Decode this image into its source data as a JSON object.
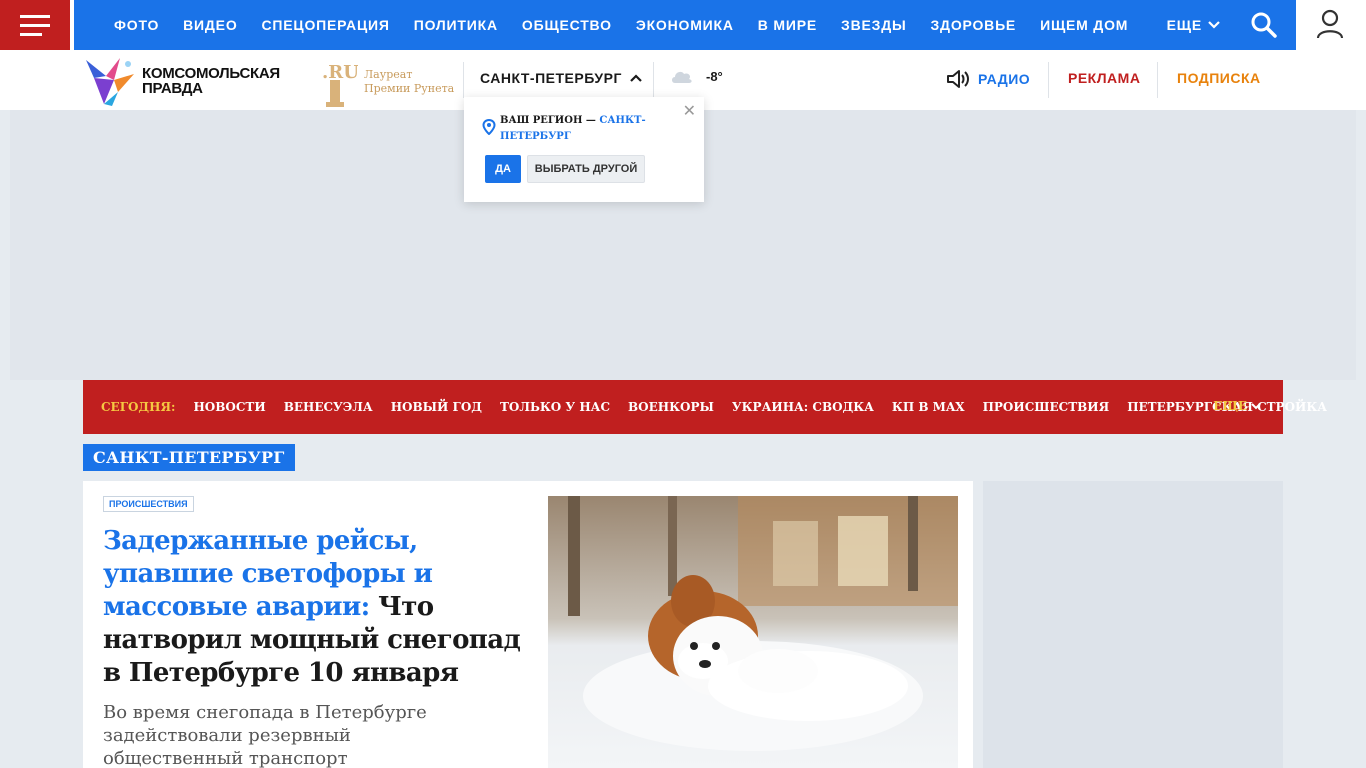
{
  "nav": {
    "items": [
      "ФОТО",
      "ВИДЕО",
      "СПЕЦОПЕРАЦИЯ",
      "ПОЛИТИКА",
      "ОБЩЕСТВО",
      "ЭКОНОМИКА",
      "В МИРЕ",
      "ЗВЕЗДЫ",
      "ЗДОРОВЬЕ",
      "ИЩЕМ ДОМ"
    ],
    "more_label": "ЕЩЕ"
  },
  "header": {
    "logo_line1": "КОМСОМОЛЬСКАЯ",
    "logo_line2": "ПРАВДА",
    "laureate_line1": "Лауреат",
    "laureate_line2": "Премии Рунета",
    "city": "САНКТ-ПЕТЕРБУРГ",
    "temperature": "-8°",
    "radio_label": "РАДИО",
    "ads_label": "РЕКЛАМА",
    "subscribe_label": "ПОДПИСКА"
  },
  "region_popup": {
    "prefix": "ВАШ РЕГИОН —",
    "region": "САНКТ-ПЕТЕРБУРГ",
    "yes_label": "ДА",
    "other_label": "ВЫБРАТЬ ДРУГОЙ"
  },
  "hot_bar": {
    "today_label": "СЕГОДНЯ:",
    "items": [
      "НОВОСТИ",
      "ВЕНЕСУЭЛА",
      "НОВЫЙ ГОД",
      "ТОЛЬКО У НАС",
      "ВОЕНКОРЫ",
      "УКРАИНА: СВОДКА",
      "КП В MAX",
      "ПРОИСШЕСТВИЯ",
      "ПЕТЕРБУРГСКАЯ СТРОЙКА"
    ],
    "more_label": "ЕЩЕ"
  },
  "section_label": "САНКТ-ПЕТЕРБУРГ",
  "article": {
    "tag": "ПРОИСШЕСТВИЯ",
    "headline_blue": "Задержанные рейсы, упавшие светофоры и массовые аварии:",
    "headline_black": "Что натворил мощный снегопад в Петербурге 10 января",
    "lead": "Во время снегопада в Петербурге задействовали резервный общественный транспорт"
  },
  "colors": {
    "nav_blue": "#1a73e8",
    "brand_red": "#c01f1f",
    "accent_orange": "#e8820c",
    "hot_yellow": "#f5c842"
  }
}
